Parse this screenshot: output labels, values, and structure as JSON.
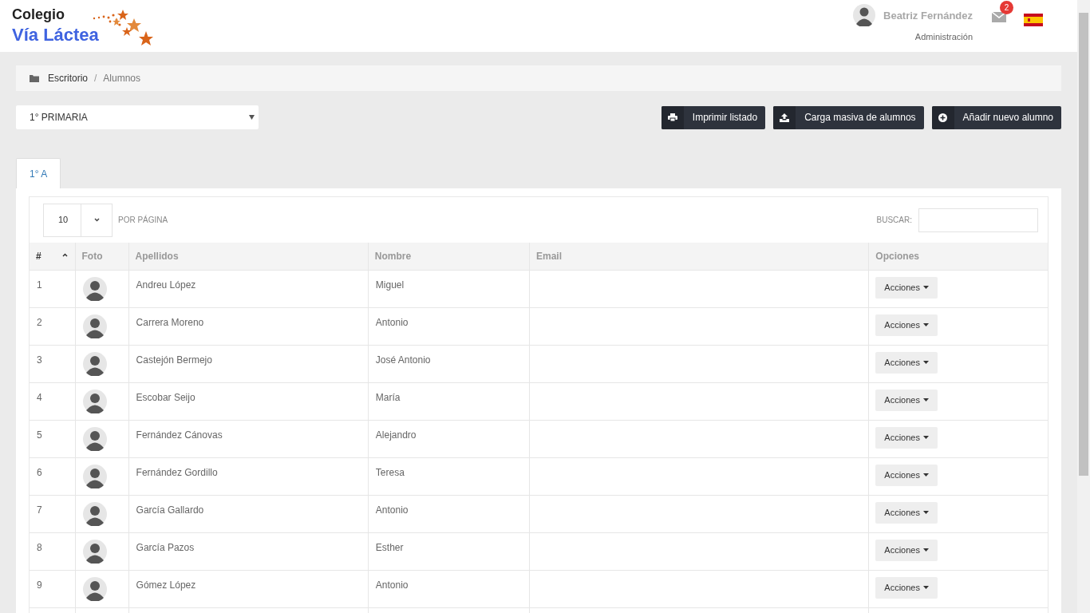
{
  "logo": {
    "line_1": "Colegio",
    "line_2": "Vía Láctea"
  },
  "user": {
    "name": "Beatriz Fernández",
    "role": "Administración"
  },
  "messages": {
    "badge": "2"
  },
  "breadcrumb": [
    "Escritorio",
    "Alumnos"
  ],
  "breadcrumb_separator": "/",
  "course_select": {
    "value": "1° PRIMARIA"
  },
  "buttons": [
    {
      "kind": "print",
      "label": "Imprimir listado"
    },
    {
      "kind": "upload",
      "label": "Carga masiva de alumnos"
    },
    {
      "kind": "add",
      "label": "Añadir nuevo alumno"
    }
  ],
  "tabs": [
    {
      "label": "1° A",
      "selected": true
    }
  ],
  "page_size": {
    "value": "10",
    "label": "POR PÁGINA"
  },
  "search": {
    "label": "BUSCAR:"
  },
  "table": {
    "columns": [
      "#",
      "Foto",
      "Apellidos",
      "Nombre",
      "Email",
      "Opciones"
    ],
    "rows": [
      {
        "num": "1",
        "surname": "Andreu López",
        "name": "Miguel",
        "action": "Acciones"
      },
      {
        "num": "2",
        "surname": "Carrera Moreno",
        "name": "Antonio",
        "action": "Acciones"
      },
      {
        "num": "3",
        "surname": "Castejón Bermejo",
        "name": "José Antonio",
        "action": "Acciones"
      },
      {
        "num": "4",
        "surname": "Escobar Seijo",
        "name": "María",
        "action": "Acciones"
      },
      {
        "num": "5",
        "surname": "Fernández Cánovas",
        "name": "Alejandro",
        "action": "Acciones"
      },
      {
        "num": "6",
        "surname": "Fernández Gordillo",
        "name": "Teresa",
        "action": "Acciones"
      },
      {
        "num": "7",
        "surname": "García Gallardo",
        "name": "Antonio",
        "action": "Acciones"
      },
      {
        "num": "8",
        "surname": "García Pazos",
        "name": "Esther",
        "action": "Acciones"
      },
      {
        "num": "9",
        "surname": "Gómez López",
        "name": "Antonio",
        "action": "Acciones"
      }
    ]
  }
}
